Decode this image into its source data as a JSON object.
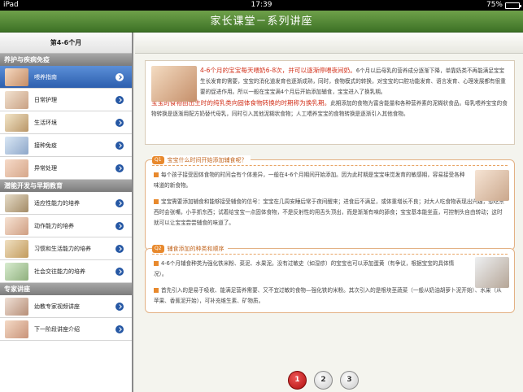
{
  "status_bar": {
    "device": "iPad",
    "time": "17:39",
    "battery": "75%",
    "battery_level": 0.75
  },
  "header": {
    "title": "家长课堂－系列讲座"
  },
  "sidebar": {
    "title": "第4-6个月",
    "sections": [
      {
        "title": "养护与疾病免疫",
        "items": [
          {
            "label": "喂养指南",
            "active": true
          },
          {
            "label": "日常护理"
          },
          {
            "label": "生活环境"
          },
          {
            "label": "接种免疫"
          },
          {
            "label": "异常处理"
          }
        ]
      },
      {
        "title": "潜能开发与早期教育",
        "items": [
          {
            "label": "适应性能力的培养"
          },
          {
            "label": "动作能力的培养"
          },
          {
            "label": "习惯和生活能力的培养"
          },
          {
            "label": "社会交往能力的培养"
          }
        ]
      },
      {
        "title": "专家讲座",
        "items": [
          {
            "label": "幼教专家视频讲座"
          },
          {
            "label": "下一阶段讲座介绍"
          }
        ]
      }
    ]
  },
  "intro": {
    "heading1": "4-6个月的宝宝每天喂奶6-8次，并可以逐渐停喂夜间奶。",
    "text1": "6个月以后母乳的营养成分逐渐下降，单靠奶类不再能满足宝宝生长发育的需要，宝宝的消化道发育也逐渐成熟，同时，食物模式的转换，对宝宝的口腔功能发育、语言发育、心理发展都有很重要的促进作用。所以一般在宝宝满4个月后开始添加辅食，宝宝进入了换乳期。",
    "heading2": "宝宝的食物由出生时的纯乳类向固体食物转换的时期称为换乳期。",
    "text2": "此期添加的食物为富含能量和各种营养素的泥糊状食品。母乳喂养宝宝的食物转换是逐渐用配方奶替代母乳，同时引入其他泥糊状食物；人工喂养宝宝的食物转换是逐渐引入其他食物。"
  },
  "card1": {
    "tag": "Q1",
    "title": "宝宝什么时间开始添加辅食呢？",
    "p1": "每个孩子接受固体食物的时间会有个体差异，一般在4-6个月期间开始添加。因为此时期是宝宝味觉发育的敏感期，容易接受各种味道的新食物。",
    "p2": "宝宝需要添加辅食和能够接受辅食的信号：宝宝在几周安睡后常于夜间醒来；进食后不满足，或体重增长不良；对大人吃食物表现出兴趣，想吃东西时会张嘴，小手抓东西；试着给宝宝一点固体食物，不是反射性的用舌头顶出，而是渐渐有味的舔食；宝宝基本能坐直，可控制头自由转动；这时就可以让宝宝尝尝辅食的味道了。"
  },
  "card2": {
    "tag": "Q2",
    "title": "辅食添加的种类和顺序",
    "p1": "4-6个月辅食种类为强化铁米粉、菜泥、水果泥。没有过敏史（如湿疹）的宝宝也可以添加蛋黄（有争议，根据宝宝的具体情况）。",
    "p2": "首先引入的是易于吸收、能满足营养需要、又不宜过敏的食物—强化铁的米粉。其次引入的是根块茎蔬菜（一般从奶油胡萝卜泥开始）、水果（从苹果、香蕉泥开始），可补充维生素、矿物质。"
  },
  "pagination": {
    "pages": [
      "1",
      "2",
      "3"
    ],
    "current": "1"
  },
  "colors": {
    "header_green": "#4f8a33",
    "sidebar_active": "#3e72c2",
    "accent_orange": "#e8892d",
    "heading_red": "#d2301a"
  }
}
